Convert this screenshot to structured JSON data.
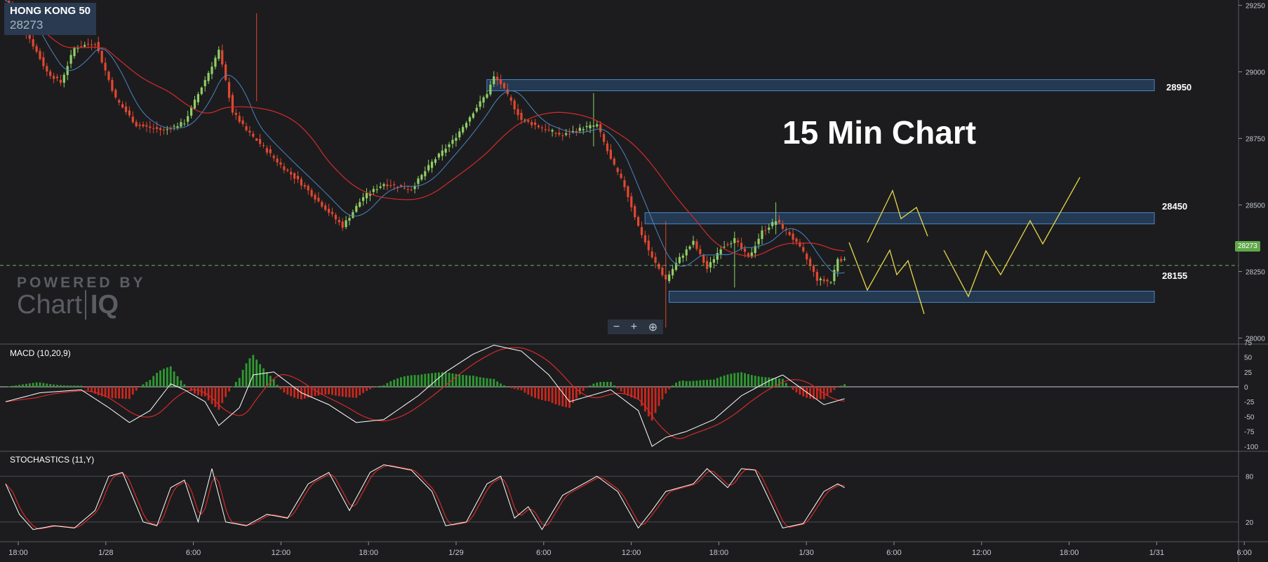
{
  "instrument": {
    "name": "HONG KONG 50",
    "price": "28273"
  },
  "title": "15 Min Chart",
  "watermark": {
    "top": "POWERED BY",
    "main": "Chart",
    "suffix": "IQ"
  },
  "zoom": {
    "minus": "−",
    "plus": "+",
    "reset": "⊕"
  },
  "macd_label": "MACD (10,20,9)",
  "stoch_label": "STOCHASTICS (11,Y)",
  "levels": [
    {
      "label": "28950"
    },
    {
      "label": "28450"
    },
    {
      "label": "28155"
    }
  ],
  "colors": {
    "background": "#1c1c1e",
    "up": "#8fd066",
    "down": "#e04830",
    "ma_fast": "#4a86c4",
    "ma_slow": "#d42a2a",
    "zone": "#2e5d92",
    "projection": "#e8d84a",
    "current": "#6fb05a"
  },
  "chart_data": [
    {
      "type": "candlestick",
      "name": "price",
      "ylim": [
        27980,
        29270
      ],
      "y_ticks": [
        28000,
        28250,
        28500,
        28750,
        29000,
        29250
      ],
      "x_ticks": [
        "18:00",
        "1/28",
        "6:00",
        "12:00",
        "18:00",
        "1/29",
        "6:00",
        "12:00",
        "18:00",
        "1/30",
        "6:00",
        "12:00",
        "18:00",
        "1/31",
        "6:00"
      ],
      "current_price": 28273,
      "close_anchors": [
        [
          0,
          29270
        ],
        [
          6,
          29150
        ],
        [
          12,
          29000
        ],
        [
          16,
          28960
        ],
        [
          20,
          29090
        ],
        [
          26,
          29110
        ],
        [
          32,
          28900
        ],
        [
          38,
          28800
        ],
        [
          46,
          28780
        ],
        [
          52,
          28810
        ],
        [
          58,
          28970
        ],
        [
          62,
          29080
        ],
        [
          66,
          28850
        ],
        [
          70,
          28780
        ],
        [
          74,
          28730
        ],
        [
          80,
          28650
        ],
        [
          86,
          28580
        ],
        [
          92,
          28500
        ],
        [
          98,
          28420
        ],
        [
          104,
          28530
        ],
        [
          110,
          28580
        ],
        [
          118,
          28560
        ],
        [
          124,
          28660
        ],
        [
          130,
          28740
        ],
        [
          136,
          28850
        ],
        [
          140,
          28920
        ],
        [
          142,
          28980
        ],
        [
          144,
          28955
        ],
        [
          150,
          28820
        ],
        [
          156,
          28790
        ],
        [
          162,
          28760
        ],
        [
          168,
          28790
        ],
        [
          172,
          28800
        ],
        [
          176,
          28670
        ],
        [
          180,
          28570
        ],
        [
          184,
          28420
        ],
        [
          188,
          28300
        ],
        [
          192,
          28220
        ],
        [
          196,
          28300
        ],
        [
          200,
          28360
        ],
        [
          204,
          28260
        ],
        [
          208,
          28340
        ],
        [
          212,
          28370
        ],
        [
          216,
          28300
        ],
        [
          220,
          28400
        ],
        [
          224,
          28440
        ],
        [
          228,
          28390
        ],
        [
          232,
          28320
        ],
        [
          236,
          28220
        ],
        [
          240,
          28210
        ],
        [
          242,
          28300
        ],
        [
          244,
          28290
        ]
      ],
      "spikes": [
        [
          73,
          29220,
          28890
        ],
        [
          171,
          28920,
          28720
        ],
        [
          192,
          28440,
          28040
        ],
        [
          212,
          28400,
          28190
        ],
        [
          224,
          28510,
          28390
        ]
      ],
      "ma_fast_offset": -20,
      "ma_slow_offset": 55
    },
    {
      "type": "zones",
      "levels": [
        28950,
        28450,
        28155
      ],
      "zone_start_idx": [
        142,
        188,
        195
      ]
    },
    {
      "type": "projection",
      "paths": [
        [
          [
            1210,
            346
          ],
          [
            1236,
            414
          ],
          [
            1268,
            357
          ],
          [
            1278,
            392
          ],
          [
            1294,
            372
          ],
          [
            1317,
            448
          ]
        ],
        [
          [
            1236,
            346
          ],
          [
            1272,
            272
          ],
          [
            1284,
            312
          ],
          [
            1306,
            296
          ],
          [
            1322,
            337
          ]
        ],
        [
          [
            1345,
            357
          ],
          [
            1380,
            423
          ],
          [
            1405,
            358
          ],
          [
            1426,
            392
          ],
          [
            1468,
            315
          ],
          [
            1486,
            348
          ],
          [
            1539,
            253
          ]
        ]
      ]
    },
    {
      "type": "macd",
      "ylim": [
        -120,
        85
      ],
      "y_ticks": [
        75,
        50,
        25,
        0,
        -25,
        -50,
        -75,
        -100
      ],
      "anchors": [
        [
          0,
          -25
        ],
        [
          10,
          -10
        ],
        [
          22,
          -5
        ],
        [
          30,
          -35
        ],
        [
          36,
          -60
        ],
        [
          42,
          -40
        ],
        [
          48,
          5
        ],
        [
          52,
          -5
        ],
        [
          58,
          -25
        ],
        [
          62,
          -65
        ],
        [
          68,
          -35
        ],
        [
          72,
          20
        ],
        [
          78,
          25
        ],
        [
          86,
          -10
        ],
        [
          94,
          -30
        ],
        [
          102,
          -60
        ],
        [
          110,
          -55
        ],
        [
          120,
          -15
        ],
        [
          128,
          25
        ],
        [
          136,
          55
        ],
        [
          142,
          70
        ],
        [
          150,
          60
        ],
        [
          158,
          20
        ],
        [
          164,
          -25
        ],
        [
          170,
          -15
        ],
        [
          176,
          -5
        ],
        [
          184,
          -40
        ],
        [
          188,
          -100
        ],
        [
          192,
          -85
        ],
        [
          198,
          -75
        ],
        [
          206,
          -55
        ],
        [
          214,
          -15
        ],
        [
          222,
          10
        ],
        [
          226,
          20
        ],
        [
          232,
          -5
        ],
        [
          238,
          -30
        ],
        [
          244,
          -20
        ]
      ],
      "signal_lag": 3
    },
    {
      "type": "stochastics",
      "ylim": [
        -5,
        110
      ],
      "y_ticks": [
        80,
        20
      ],
      "anchors": [
        [
          0,
          70
        ],
        [
          4,
          30
        ],
        [
          8,
          10
        ],
        [
          14,
          15
        ],
        [
          20,
          12
        ],
        [
          26,
          35
        ],
        [
          30,
          80
        ],
        [
          34,
          85
        ],
        [
          40,
          20
        ],
        [
          44,
          15
        ],
        [
          48,
          65
        ],
        [
          52,
          75
        ],
        [
          56,
          20
        ],
        [
          60,
          90
        ],
        [
          64,
          20
        ],
        [
          70,
          15
        ],
        [
          76,
          30
        ],
        [
          82,
          25
        ],
        [
          88,
          70
        ],
        [
          94,
          85
        ],
        [
          100,
          35
        ],
        [
          106,
          85
        ],
        [
          110,
          95
        ],
        [
          118,
          88
        ],
        [
          124,
          60
        ],
        [
          128,
          15
        ],
        [
          134,
          20
        ],
        [
          140,
          70
        ],
        [
          144,
          80
        ],
        [
          148,
          25
        ],
        [
          152,
          40
        ],
        [
          156,
          10
        ],
        [
          162,
          55
        ],
        [
          166,
          65
        ],
        [
          172,
          80
        ],
        [
          178,
          60
        ],
        [
          184,
          12
        ],
        [
          188,
          35
        ],
        [
          192,
          60
        ],
        [
          200,
          70
        ],
        [
          204,
          90
        ],
        [
          210,
          65
        ],
        [
          214,
          90
        ],
        [
          218,
          88
        ],
        [
          222,
          50
        ],
        [
          226,
          12
        ],
        [
          232,
          18
        ],
        [
          238,
          60
        ],
        [
          242,
          70
        ],
        [
          244,
          65
        ]
      ]
    }
  ]
}
